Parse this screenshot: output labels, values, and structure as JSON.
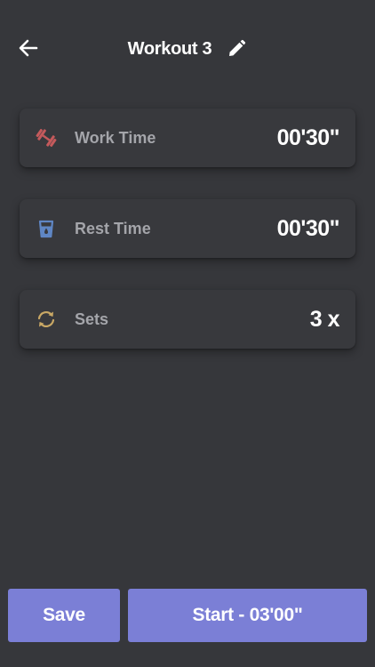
{
  "header": {
    "title": "Workout 3",
    "back_icon": "arrow-left-icon",
    "edit_icon": "pencil-icon"
  },
  "settings": [
    {
      "label": "Work Time",
      "value": "00'30\"",
      "icon": "dumbbell-icon",
      "icon_color": "#c55a5c"
    },
    {
      "label": "Rest Time",
      "value": "00'30\"",
      "icon": "glass-icon",
      "icon_color": "#5f86c4"
    },
    {
      "label": "Sets",
      "value": "3 x",
      "icon": "repeat-icon",
      "icon_color": "#c9a865"
    }
  ],
  "actions": {
    "save_label": "Save",
    "start_label": "Start - 03'00\""
  },
  "colors": {
    "background": "#36373b",
    "card": "#38393d",
    "accent": "#7b7fd6",
    "label": "#a4a5aa"
  }
}
